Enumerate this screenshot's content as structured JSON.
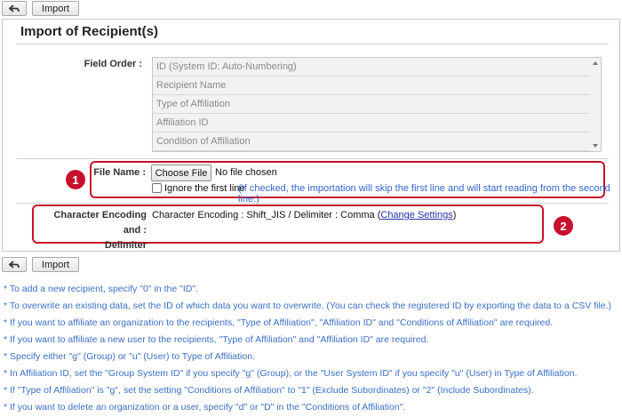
{
  "toolbar": {
    "back_icon": "back-arrow-icon",
    "import_label": "Import"
  },
  "panel": {
    "title": "Import of Recipient(s)"
  },
  "field_order": {
    "label": "Field Order :",
    "options": [
      "ID (System ID: Auto-Numbering)",
      "Recipient Name",
      "Type of Affiliation",
      "Affiliation ID",
      "Condition of Affiliation"
    ]
  },
  "file_name": {
    "label": "File Name :",
    "choose_button": "Choose File",
    "status": "No file chosen",
    "ignore_label": "Ignore the first line",
    "ignore_note": "(If checked, the importation will skip the first line and will start reading from the second line.)",
    "badge": "1"
  },
  "encoding": {
    "label_line1": "Character Encoding and :",
    "label_line2": "Delimiter",
    "text": "Character Encoding : Shift_JIS / Delimiter : Comma (",
    "link": "Change Settings",
    "text_end": ")",
    "badge": "2"
  },
  "notes": [
    "* To add a new recipient, specify \"0\" in the \"ID\".",
    "* To overwrite an existing data, set the ID of which data you want to overwrite. (You can check the registered ID by exporting the data to a CSV file.)",
    "* If you want to affiliate an organization to the recipients, \"Type of Affiliation\", \"Affiliation ID\" and \"Conditions of Affiliation\" are required.",
    "* If you want to affiliate a new user to the recipients, \"Type of Affiliation\" and \"Affiliation ID\" are required.",
    "* Specify either \"g\" (Group) or \"u\" (User) to Type of Affiliation.",
    "* In Affiliation ID, set the \"Group System ID\" if you specify \"g\" (Group), or the \"User System ID\" if you specify \"u\" (User) in Type of Affiliation.",
    "* If \"Type of Affiliation\" is \"g\", set the setting \"Conditions of Affiliation\" to \"1\" (Exclude Subordinates) or \"2\" (Include Subordinates).",
    "* If you want to delete an organization or a user, specify \"d\" or \"D\" in the \"Conditions of Affiliation\"."
  ],
  "colors": {
    "highlight": "#c8102e",
    "note_text": "#3b6fc4",
    "link": "#2233aa"
  }
}
